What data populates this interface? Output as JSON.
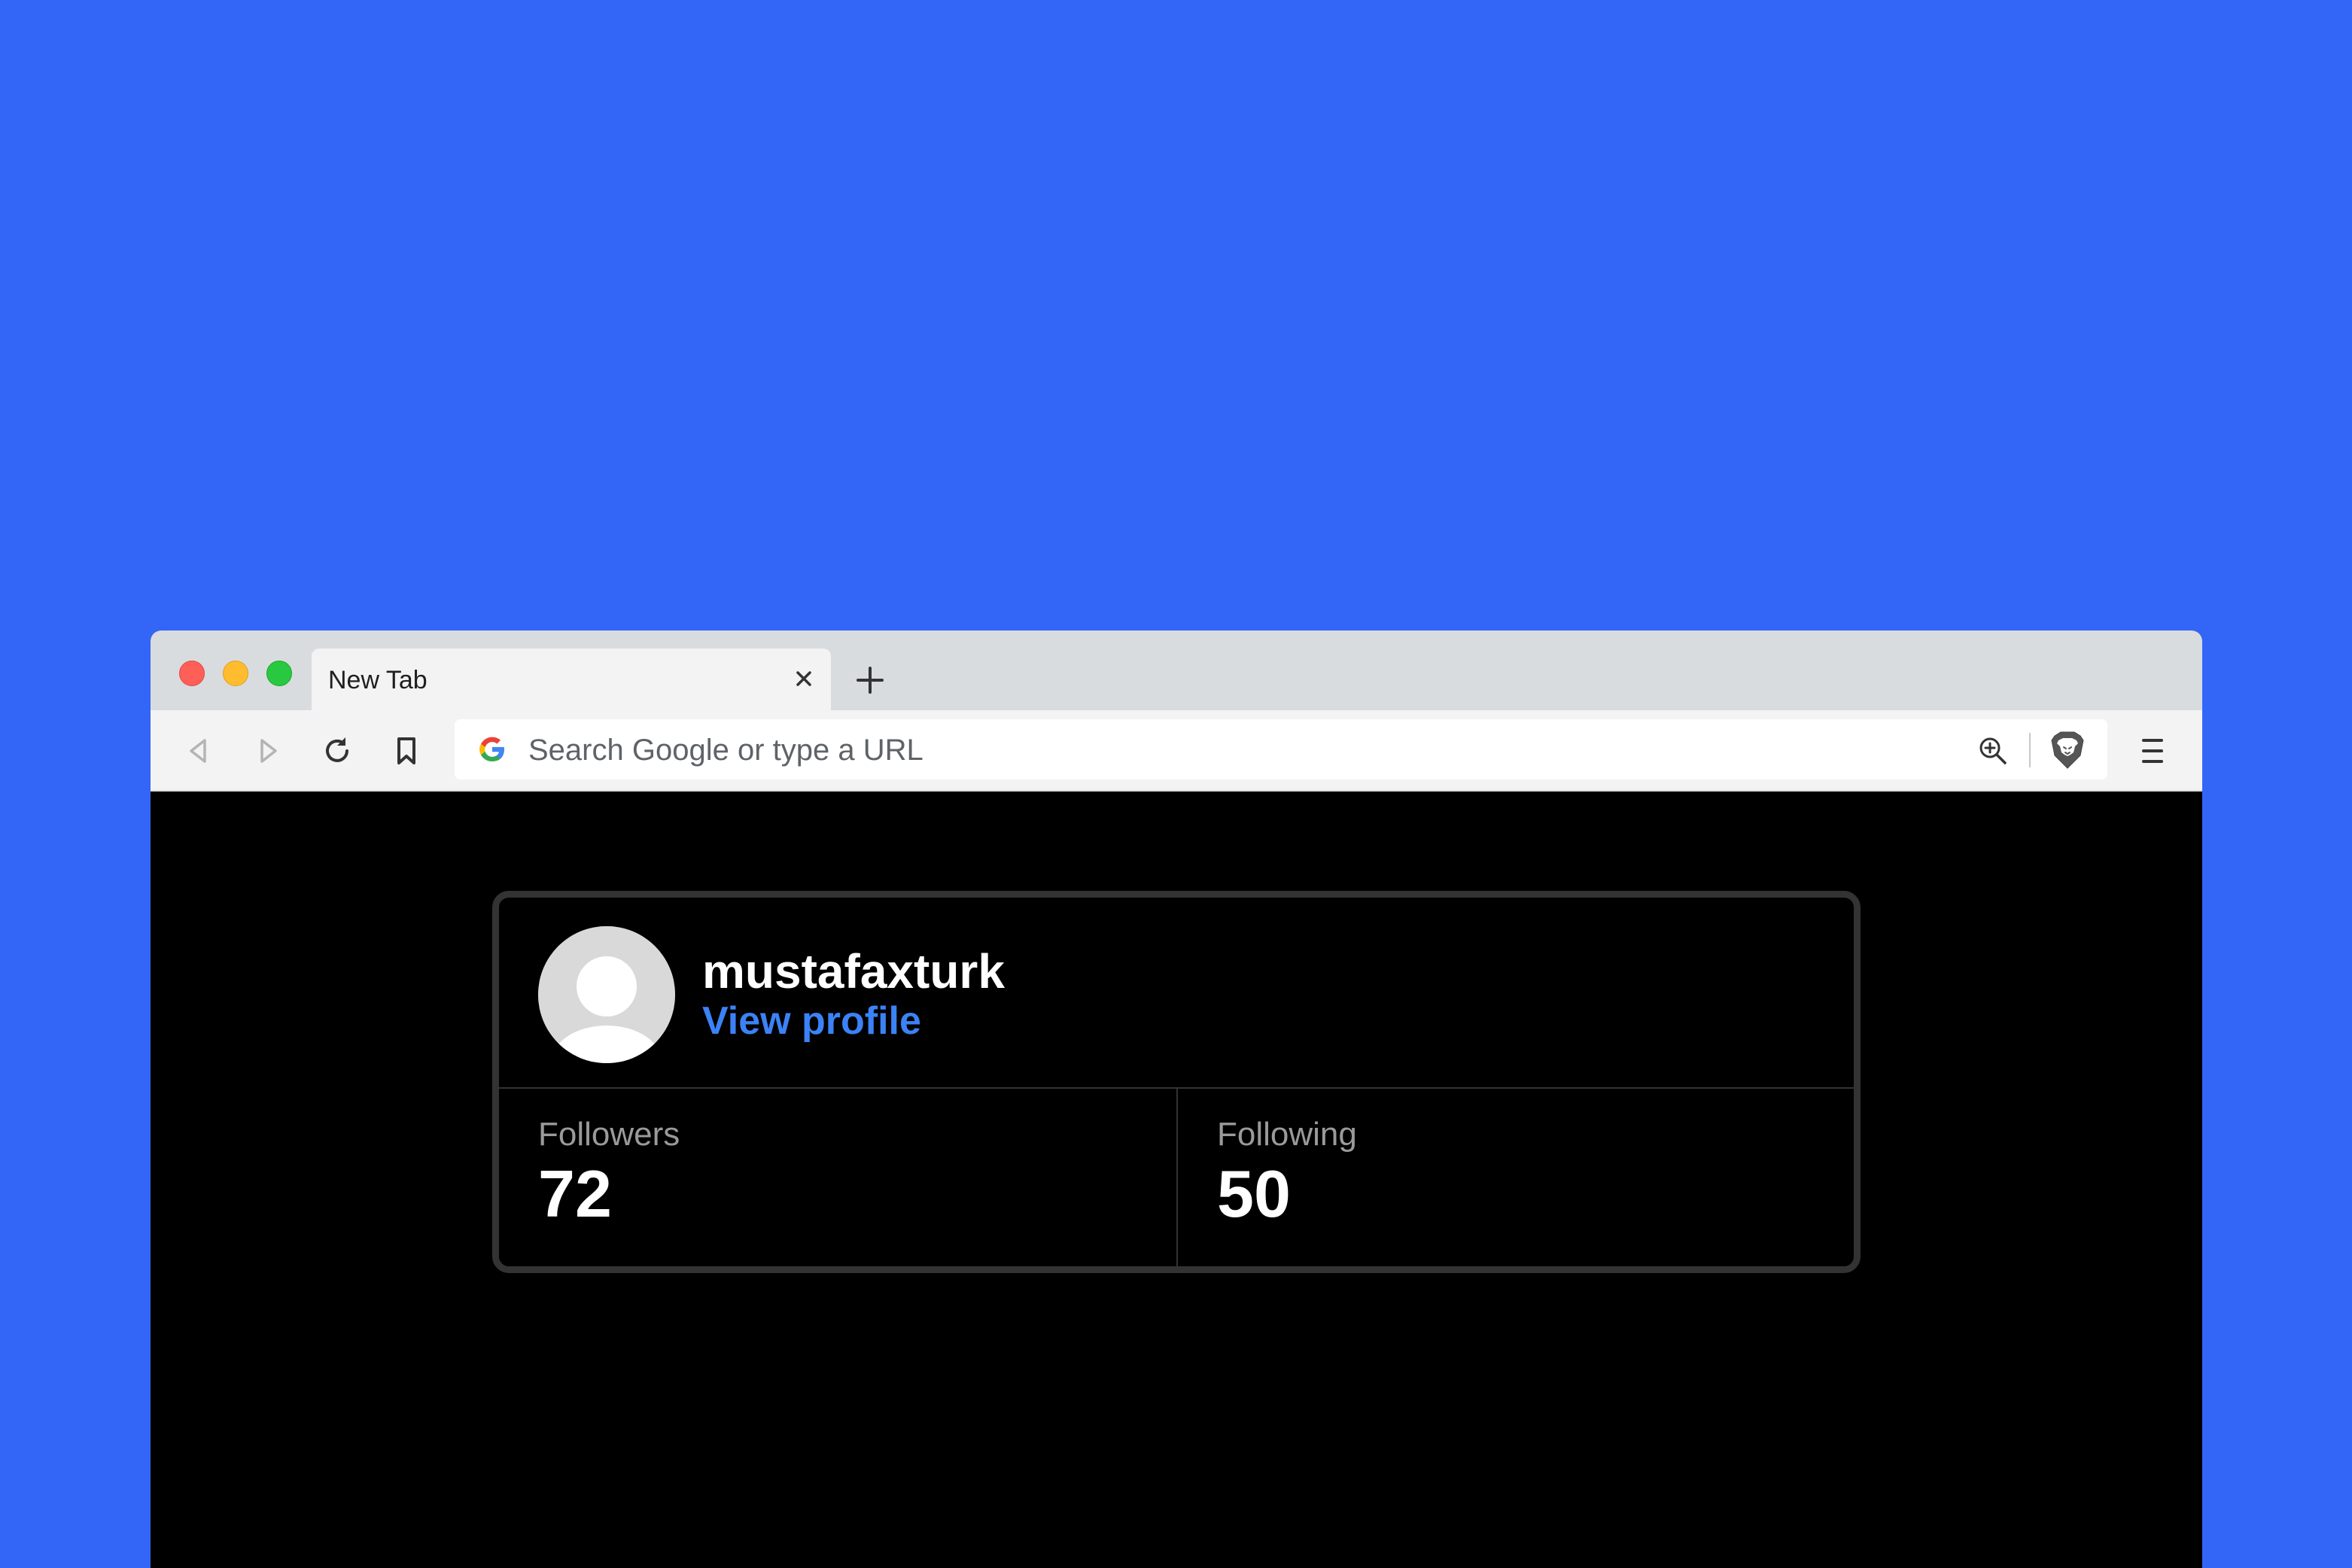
{
  "browser": {
    "tab": {
      "title": "New Tab"
    },
    "omnibox": {
      "placeholder": "Search Google or type a URL"
    },
    "icons": {
      "back": "back-arrow-icon",
      "forward": "forward-arrow-icon",
      "reload": "reload-icon",
      "bookmark": "bookmark-icon",
      "search_engine": "google-g-icon",
      "zoom": "zoom-in-icon",
      "shields": "brave-lion-icon",
      "menu": "hamburger-menu-icon"
    }
  },
  "profile_card": {
    "username": "mustafaxturk",
    "view_profile_label": "View profile",
    "stats": [
      {
        "label": "Followers",
        "value": "72"
      },
      {
        "label": "Following",
        "value": "50"
      }
    ]
  },
  "colors": {
    "backdrop": "#3366f7",
    "link": "#3b82f6",
    "card_border": "#333333",
    "page_background": "#000000"
  }
}
